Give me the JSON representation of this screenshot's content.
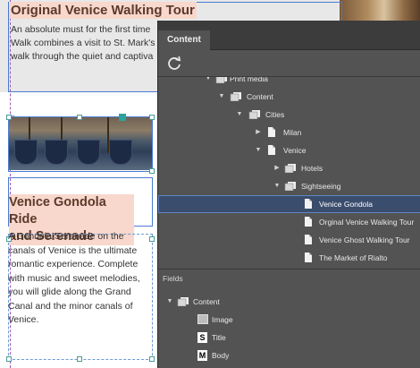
{
  "document": {
    "tour_title": "Original Venice Walking Tour",
    "tour_text_lines": [
      "An absolute must for the first time",
      "Walk combines a visit to St. Mark's",
      "walk through the quiet and captiva"
    ],
    "gondola_title_lines": [
      "Venice Gondola Ride",
      "and Serenade"
    ],
    "gondola_text_lines": [
      "A Gondola Serenade on the",
      "canals of Venice is the ultimate",
      "romantic experience. Complete",
      "with music and sweet melodies,",
      "you will glide along the Grand",
      "Canal and the minor canals of",
      "Venice."
    ],
    "link_badge": "∞"
  },
  "panel": {
    "tab_label": "Content",
    "refresh_icon": "refresh-icon",
    "tree": [
      {
        "label": "Print media",
        "expanded": true,
        "type": "folder"
      },
      {
        "label": "Content",
        "expanded": true,
        "type": "folder"
      },
      {
        "label": "Cities",
        "expanded": true,
        "type": "folder"
      },
      {
        "label": "Milan",
        "expanded": false,
        "type": "folder"
      },
      {
        "label": "Venice",
        "expanded": true,
        "type": "doc"
      },
      {
        "label": "Hotels",
        "expanded": false,
        "type": "folder"
      },
      {
        "label": "Sightseeing",
        "expanded": true,
        "type": "folder"
      },
      {
        "label": "Venice Gondola",
        "type": "doc",
        "selected": true
      },
      {
        "label": "Orginal Venice Walking Tour",
        "type": "doc"
      },
      {
        "label": "Venice Ghost Walking Tour",
        "type": "doc"
      },
      {
        "label": "The Market of Rialto",
        "type": "doc"
      }
    ],
    "fields_header": "Fields",
    "fields": [
      {
        "label": "Content",
        "badge": "folder"
      },
      {
        "label": "Image",
        "badge": "image"
      },
      {
        "label": "Title",
        "badge": "S"
      },
      {
        "label": "Body",
        "badge": "M"
      }
    ]
  },
  "colors": {
    "panel_bg": "#535353",
    "selected_row": "#3b4d6d",
    "heading_highlight": "#f8d7cc",
    "frame_blue": "#4a7bd1",
    "guide_purple": "#9b59b6"
  }
}
